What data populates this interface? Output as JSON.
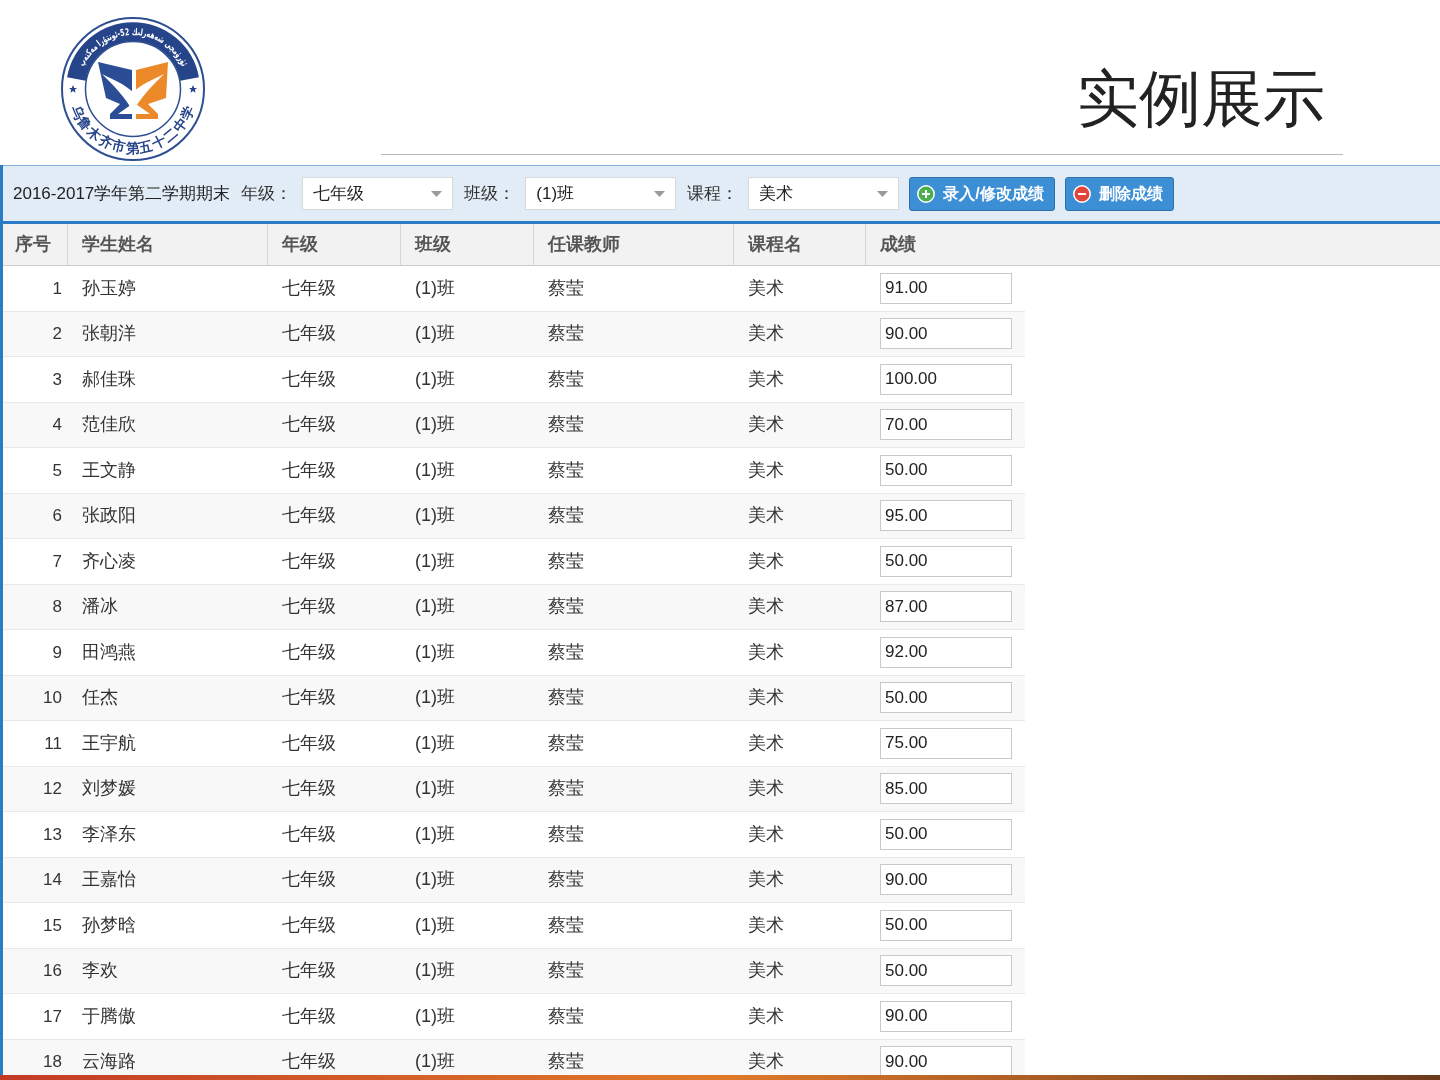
{
  "slide": {
    "title": "实例展示"
  },
  "logo": {
    "top_text": "ئۈرۈمچى شەھەرلىك 52-ئوتتۇرا مەكتەپ",
    "bottom_text": "乌鲁木齐市第五十二中学"
  },
  "toolbar": {
    "term": "2016-2017学年第二学期期末",
    "filters": [
      {
        "label": "年级：",
        "value": "七年级"
      },
      {
        "label": "班级：",
        "value": "(1)班"
      },
      {
        "label": "课程：",
        "value": "美术"
      }
    ],
    "buttons": [
      {
        "kind": "add",
        "label": "录入/修改成绩"
      },
      {
        "kind": "delete",
        "label": "删除成绩"
      }
    ]
  },
  "table": {
    "columns": [
      "序号",
      "学生姓名",
      "年级",
      "班级",
      "任课教师",
      "课程名",
      "成绩"
    ],
    "rows": [
      {
        "number": "1",
        "student": "孙玉婷",
        "grade": "七年级",
        "class": "(1)班",
        "teacher": "蔡莹",
        "course": "美术",
        "score": "91.00"
      },
      {
        "number": "2",
        "student": "张朝洋",
        "grade": "七年级",
        "class": "(1)班",
        "teacher": "蔡莹",
        "course": "美术",
        "score": "90.00"
      },
      {
        "number": "3",
        "student": "郝佳珠",
        "grade": "七年级",
        "class": "(1)班",
        "teacher": "蔡莹",
        "course": "美术",
        "score": "100.00"
      },
      {
        "number": "4",
        "student": "范佳欣",
        "grade": "七年级",
        "class": "(1)班",
        "teacher": "蔡莹",
        "course": "美术",
        "score": "70.00"
      },
      {
        "number": "5",
        "student": "王文静",
        "grade": "七年级",
        "class": "(1)班",
        "teacher": "蔡莹",
        "course": "美术",
        "score": "50.00"
      },
      {
        "number": "6",
        "student": "张政阳",
        "grade": "七年级",
        "class": "(1)班",
        "teacher": "蔡莹",
        "course": "美术",
        "score": "95.00"
      },
      {
        "number": "7",
        "student": "齐心凌",
        "grade": "七年级",
        "class": "(1)班",
        "teacher": "蔡莹",
        "course": "美术",
        "score": "50.00"
      },
      {
        "number": "8",
        "student": "潘冰",
        "grade": "七年级",
        "class": "(1)班",
        "teacher": "蔡莹",
        "course": "美术",
        "score": "87.00"
      },
      {
        "number": "9",
        "student": "田鸿燕",
        "grade": "七年级",
        "class": "(1)班",
        "teacher": "蔡莹",
        "course": "美术",
        "score": "92.00"
      },
      {
        "number": "10",
        "student": "任杰",
        "grade": "七年级",
        "class": "(1)班",
        "teacher": "蔡莹",
        "course": "美术",
        "score": "50.00"
      },
      {
        "number": "11",
        "student": "王宇航",
        "grade": "七年级",
        "class": "(1)班",
        "teacher": "蔡莹",
        "course": "美术",
        "score": "75.00"
      },
      {
        "number": "12",
        "student": "刘梦媛",
        "grade": "七年级",
        "class": "(1)班",
        "teacher": "蔡莹",
        "course": "美术",
        "score": "85.00"
      },
      {
        "number": "13",
        "student": "李泽东",
        "grade": "七年级",
        "class": "(1)班",
        "teacher": "蔡莹",
        "course": "美术",
        "score": "50.00"
      },
      {
        "number": "14",
        "student": "王嘉怡",
        "grade": "七年级",
        "class": "(1)班",
        "teacher": "蔡莹",
        "course": "美术",
        "score": "90.00"
      },
      {
        "number": "15",
        "student": "孙梦晗",
        "grade": "七年级",
        "class": "(1)班",
        "teacher": "蔡莹",
        "course": "美术",
        "score": "50.00"
      },
      {
        "number": "16",
        "student": "李欢",
        "grade": "七年级",
        "class": "(1)班",
        "teacher": "蔡莹",
        "course": "美术",
        "score": "50.00"
      },
      {
        "number": "17",
        "student": "于腾傲",
        "grade": "七年级",
        "class": "(1)班",
        "teacher": "蔡莹",
        "course": "美术",
        "score": "90.00"
      },
      {
        "number": "18",
        "student": "云海路",
        "grade": "七年级",
        "class": "(1)班",
        "teacher": "蔡莹",
        "course": "美术",
        "score": "90.00"
      }
    ]
  }
}
